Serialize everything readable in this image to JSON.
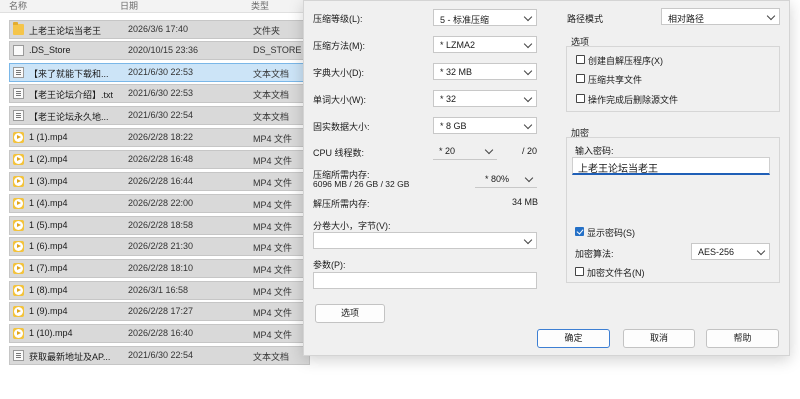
{
  "explorer": {
    "columns": {
      "name": "名称",
      "date": "日期",
      "type": "类型"
    },
    "files": [
      {
        "icon": "folder-icon",
        "name": "上老王论坛当老王",
        "date": "2026/3/6 17:40",
        "type": "文件夹"
      },
      {
        "icon": "file-icon",
        "name": ".DS_Store",
        "date": "2020/10/15 23:36",
        "type": "DS_STORE"
      },
      {
        "icon": "text-file-icon",
        "name": "【来了就能下载和...",
        "date": "2021/6/30 22:53",
        "type": "文本文档",
        "selected": true
      },
      {
        "icon": "text-file-icon",
        "name": "【老王论坛介绍】.txt",
        "date": "2021/6/30 22:53",
        "type": "文本文档"
      },
      {
        "icon": "text-file-icon",
        "name": "【老王论坛永久地...",
        "date": "2021/6/30 22:54",
        "type": "文本文档"
      },
      {
        "icon": "video-file-icon",
        "name": "1 (1).mp4",
        "date": "2026/2/28 18:22",
        "type": "MP4 文件"
      },
      {
        "icon": "video-file-icon",
        "name": "1 (2).mp4",
        "date": "2026/2/28 16:48",
        "type": "MP4 文件"
      },
      {
        "icon": "video-file-icon",
        "name": "1 (3).mp4",
        "date": "2026/2/28 16:44",
        "type": "MP4 文件"
      },
      {
        "icon": "video-file-icon",
        "name": "1 (4).mp4",
        "date": "2026/2/28 22:00",
        "type": "MP4 文件"
      },
      {
        "icon": "video-file-icon",
        "name": "1 (5).mp4",
        "date": "2026/2/28 18:58",
        "type": "MP4 文件"
      },
      {
        "icon": "video-file-icon",
        "name": "1 (6).mp4",
        "date": "2026/2/28 21:30",
        "type": "MP4 文件"
      },
      {
        "icon": "video-file-icon",
        "name": "1 (7).mp4",
        "date": "2026/2/28 18:10",
        "type": "MP4 文件"
      },
      {
        "icon": "video-file-icon",
        "name": "1 (8).mp4",
        "date": "2026/3/1 16:58",
        "type": "MP4 文件"
      },
      {
        "icon": "video-file-icon",
        "name": "1 (9).mp4",
        "date": "2026/2/28 17:27",
        "type": "MP4 文件"
      },
      {
        "icon": "video-file-icon",
        "name": "1 (10).mp4",
        "date": "2026/2/28 16:40",
        "type": "MP4 文件"
      },
      {
        "icon": "text-file-icon",
        "name": "获取最新地址及AP...",
        "date": "2021/6/30 22:54",
        "type": "文本文档"
      }
    ]
  },
  "dialog": {
    "compression_level": {
      "label": "压缩等级(L):",
      "value": "5 - 标准压缩"
    },
    "compression_method": {
      "label": "压缩方法(M):",
      "value": "* LZMA2"
    },
    "dictionary_size": {
      "label": "字典大小(D):",
      "value": "* 32 MB"
    },
    "word_size": {
      "label": "单词大小(W):",
      "value": "* 32"
    },
    "solid_block": {
      "label": "固实数据大小:",
      "value": "* 8 GB"
    },
    "cpu_threads": {
      "label": "CPU 线程数:",
      "value": "* 20",
      "max": "/ 20"
    },
    "memory_compress": {
      "label": "压缩所需内存:",
      "detail": "6096 MB / 26 GB / 32 GB",
      "value": "* 80%"
    },
    "memory_decompress": {
      "label": "解压所需内存:",
      "value": "34 MB"
    },
    "split_volume": {
      "label": "分卷大小，字节(V):",
      "value": ""
    },
    "parameters": {
      "label": "参数(P):",
      "value": ""
    },
    "options_button": "选项",
    "path_mode": {
      "label": "路径模式",
      "value": "相对路径"
    },
    "options": {
      "title": "选项",
      "items": [
        {
          "label": "创建自解压程序(X)",
          "checked": false
        },
        {
          "label": "压缩共享文件",
          "checked": false
        },
        {
          "label": "操作完成后删除源文件",
          "checked": false
        }
      ]
    },
    "encryption": {
      "title": "加密",
      "password_label": "输入密码:",
      "password_value": "上老王论坛当老王",
      "show_password": {
        "label": "显示密码(S)",
        "checked": true
      },
      "method_label": "加密算法:",
      "method_value": "AES-256",
      "encrypt_names": {
        "label": "加密文件名(N)",
        "checked": false
      }
    },
    "buttons": {
      "ok": "确定",
      "cancel": "取消",
      "help": "帮助"
    }
  }
}
